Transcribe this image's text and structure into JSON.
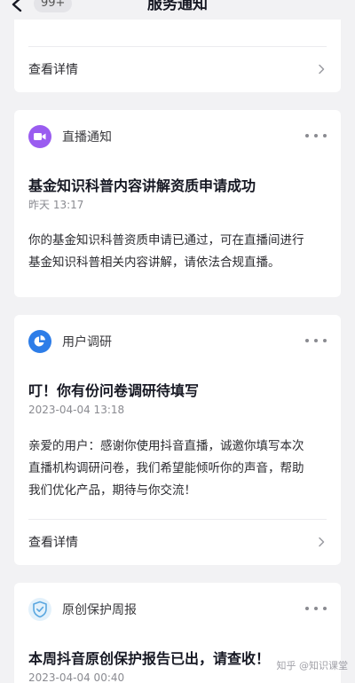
{
  "header": {
    "title": "服务通知",
    "badge": "99+"
  },
  "cards": [
    {
      "detail_label": "查看详情"
    },
    {
      "source": "直播通知",
      "icon": "video-camera-icon",
      "icon_color": "#9a5cf0",
      "title": "基金知识科普内容讲解资质申请成功",
      "time": "昨天 13:17",
      "body_lines": [
        "你的基金知识科普资质申请已通过，可在直播间进行",
        "基金知识科普相关内容讲解，请依法合规直播。"
      ]
    },
    {
      "source": "用户调研",
      "icon": "pie-chart-icon",
      "icon_color": "#2d7de8",
      "title": "叮！你有份问卷调研待填写",
      "time": "2023-04-04 13:18",
      "body_lines": [
        "亲爱的用户：感谢你使用抖音直播，诚邀你填写本次",
        "直播机构调研问卷，我们希望能倾听你的声音，帮助",
        "我们优化产品，期待与你交流！"
      ],
      "detail_label": "查看详情"
    },
    {
      "source": "原创保护周报",
      "icon": "shield-icon",
      "icon_color": "#5aa7e0",
      "title": "本周抖音原创保护报告已出，请查收！",
      "time": "2023-04-04 00:40"
    }
  ],
  "watermark": "知乎 @知识课堂"
}
